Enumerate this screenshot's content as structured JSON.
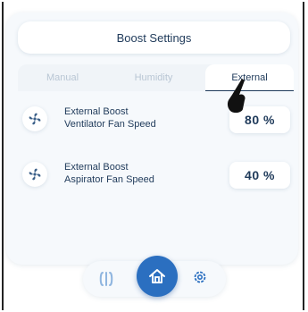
{
  "header": {
    "title": "Boost Settings"
  },
  "tabs": [
    {
      "label": "Manual",
      "active": false
    },
    {
      "label": "Humidity",
      "active": false
    },
    {
      "label": "External",
      "active": true
    }
  ],
  "rows": [
    {
      "label_line1": "External Boost",
      "label_line2": "Ventilator Fan Speed",
      "value": "80 %"
    },
    {
      "label_line1": "External Boost",
      "label_line2": "Aspirator Fan Speed",
      "value": "40 %"
    }
  ],
  "nav": {
    "items": [
      "left-icon",
      "home-icon",
      "gear-icon"
    ],
    "active": "home"
  },
  "colors": {
    "primary": "#2b6fc0",
    "text": "#1f3a5a",
    "muted": "#b9c6d4",
    "card": "#f6f9fc"
  }
}
